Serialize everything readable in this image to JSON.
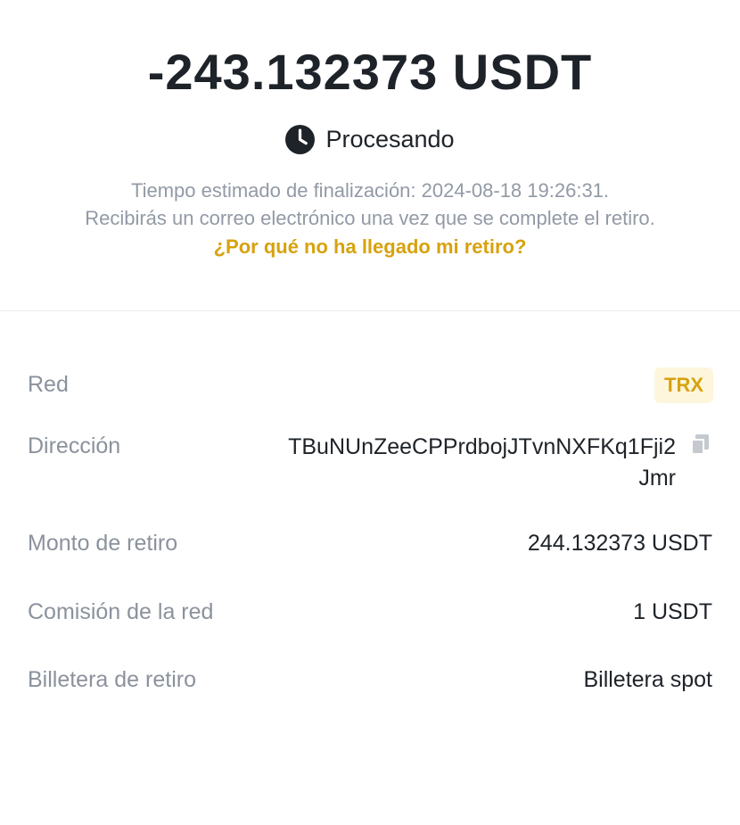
{
  "amount": "-243.132373 USDT",
  "status": {
    "icon": "clock-icon",
    "label": "Procesando"
  },
  "info": {
    "line1": "Tiempo estimado de finalización: 2024-08-18 19:26:31.",
    "line2": "Recibirás un correo electrónico una vez que se complete el retiro."
  },
  "help_link": "¿Por qué no ha llegado mi retiro?",
  "details": {
    "network": {
      "label": "Red",
      "value": "TRX"
    },
    "address": {
      "label": "Dirección",
      "value": "TBuNUnZeeCPPrdbojJTvnNXFKq1Fji2Jmr",
      "icon": "copy-icon"
    },
    "withdraw_amount": {
      "label": "Monto de retiro",
      "value": "244.132373 USDT"
    },
    "network_fee": {
      "label": "Comisión de la red",
      "value": "1 USDT"
    },
    "wallet": {
      "label": "Billetera de retiro",
      "value": "Billetera spot"
    }
  },
  "colors": {
    "accent": "#d7a20e",
    "badge_bg": "#fdf6dd",
    "text_primary": "#1e2329",
    "text_secondary": "#929aa5"
  }
}
